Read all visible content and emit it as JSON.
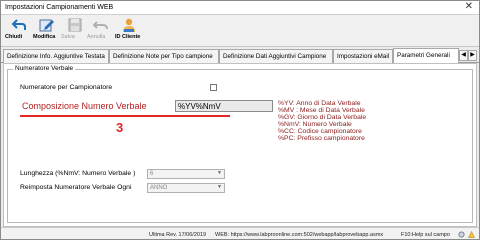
{
  "window": {
    "title": "Impostazioni Campionamenti WEB"
  },
  "toolbar": {
    "buttons": [
      {
        "label": "Chiudi",
        "icon": "back-arrow-icon",
        "enabled": true
      },
      {
        "label": "Modifica",
        "icon": "edit-icon",
        "enabled": true
      },
      {
        "label": "Salva",
        "icon": "save-icon",
        "enabled": false
      },
      {
        "label": "Annulla",
        "icon": "undo-icon",
        "enabled": false
      },
      {
        "label": "ID Cliente",
        "icon": "user-icon",
        "enabled": true
      }
    ]
  },
  "tabs": [
    {
      "label": "Definizione Info. Aggiuntive Testata",
      "active": false
    },
    {
      "label": "Definizione Note per Tipo campione",
      "active": false
    },
    {
      "label": "Definizione Dati Aggiuntivi Campione",
      "active": false
    },
    {
      "label": "Impostazioni eMail",
      "active": false
    },
    {
      "label": "Parametri Generali",
      "active": true
    }
  ],
  "group": {
    "title": "Numeratore Verbale",
    "per_campionatore_label": "Numeratore per Campionatore",
    "per_campionatore_checked": false,
    "composizione_label": "Composizione Numero Verbale",
    "composizione_value": "%YV%NmV",
    "annotation_number": "3",
    "legend": [
      "%YV: Anno di Data Verbale",
      "%MV : Mese di Data Verbale",
      "%GV: Giorno di Data Verbale",
      "%NmV: Numero Verbale",
      "%CC: Codice campionatore",
      "%PC: Prefisso campionatore"
    ],
    "lunghezza_label": "Lunghezza (%NmV: Numero Verbale )",
    "lunghezza_value": "6",
    "reimposta_label": "Reimposta Numeratore Verbale Ogni",
    "reimposta_value": "ANNO"
  },
  "status": {
    "rev": "Ultima Rev. 17/06/2019",
    "web": "WEB: https://www.labproonline.com:502/webapp/labprovebapp.asmx",
    "help": "F10:Help sul campo"
  },
  "colors": {
    "accent_red": "#e32626",
    "label_red": "#b11f1f",
    "legend_text": "#8b1a1a"
  }
}
